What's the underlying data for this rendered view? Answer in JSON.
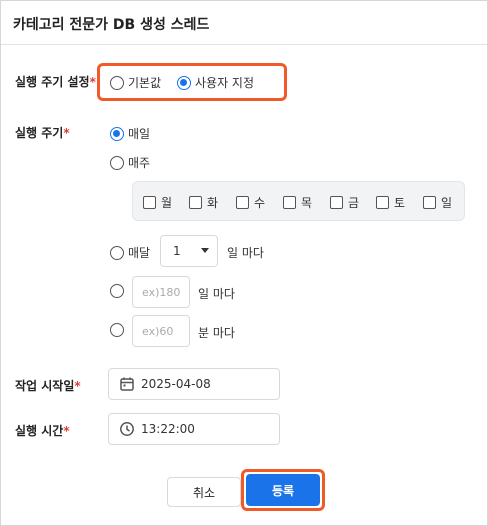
{
  "title": "카테고리 전문가 DB 생성 스레드",
  "schedule_setting": {
    "label": "실행 주기 설정",
    "required": "*",
    "options": [
      {
        "label": "기본값",
        "selected": false
      },
      {
        "label": "사용자 지정",
        "selected": true
      }
    ]
  },
  "run_cycle": {
    "label": "실행 주기",
    "required": "*",
    "daily": {
      "label": "매일",
      "selected": true
    },
    "weekly": {
      "label": "매주",
      "selected": false
    },
    "weekdays": [
      "월",
      "화",
      "수",
      "목",
      "금",
      "토",
      "일"
    ],
    "monthly": {
      "label": "매달",
      "selected": false,
      "value": "1",
      "suffix": "일 마다"
    },
    "every_days": {
      "placeholder": "ex)180",
      "suffix": "일 마다",
      "selected": false
    },
    "every_minutes": {
      "placeholder": "ex)60",
      "suffix": "분 마다",
      "selected": false
    }
  },
  "start_date": {
    "label": "작업 시작일",
    "required": "*",
    "value": "2025-04-08"
  },
  "run_time": {
    "label": "실행 시간",
    "required": "*",
    "value": "13:22:00"
  },
  "buttons": {
    "cancel": "취소",
    "save": "등록"
  },
  "colors": {
    "accent": "#1a73e8",
    "highlight": "#f05a28",
    "required": "#e53935"
  }
}
